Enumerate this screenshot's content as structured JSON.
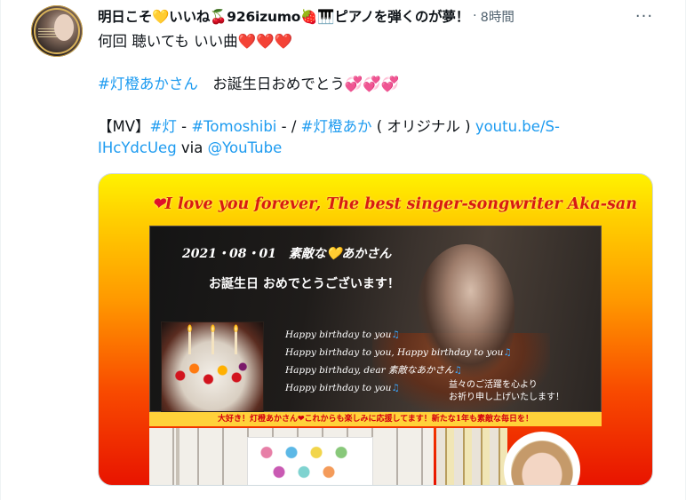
{
  "tweet": {
    "display_name": "明日こそ💛いいね🍒926izumo🍓🎹ピアノを弾くのが夢！",
    "separator": "·",
    "time_ago": "8時間",
    "more_icon": "more-horizontal-icon",
    "body": {
      "line1_text": "何回 聴いても いい曲",
      "line1_hearts": "❤️❤️❤️",
      "hashtag_akane": "#灯橙あかさん",
      "birthday_text": "お誕生日おめでとう",
      "birthday_hearts": "💞💞💞",
      "mv_prefix": "【MV】",
      "hashtag_akari": "#灯",
      "dash1": " - ",
      "hashtag_tomoshibi": "#Tomoshibi",
      "dash2": " - / ",
      "hashtag_aka": "#灯橙あか",
      "original": " ( オリジナル ) ",
      "url_part1": "youtu.be/S-",
      "url_part2": "IHcYdcUeg",
      "via": " via ",
      "mention_youtube": "@YouTube"
    }
  },
  "media": {
    "title_heart": "❤",
    "title": "I love you forever, The best singer-songwriter Aka-san",
    "date_line_pre": "2021・08・01　素敵な",
    "date_line_heart": "💛",
    "date_line_post": "あかさん",
    "congrats": "お誕生日 おめでとうございます！",
    "song_lines": [
      "Happy birthday to you",
      "Happy birthday to you, Happy birthday to you",
      "Happy birthday, dear 素敵なあかさん",
      "Happy birthday to you"
    ],
    "note": "♫",
    "wish_line1": "益々のご活躍を心より",
    "wish_line2": "お祈り申し上げいたします！",
    "cake_label": "素敵なあかさん",
    "banner": "大好き！灯橙あかさん❤これからも楽しみに応援してます！新たな1年も素敵な毎日を！"
  }
}
